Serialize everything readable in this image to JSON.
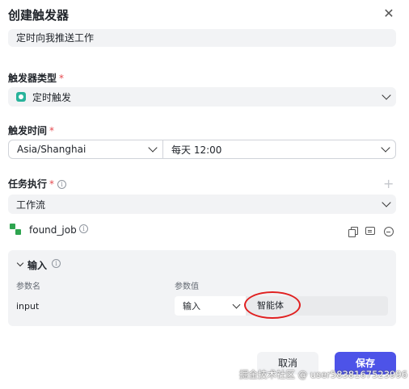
{
  "dialog": {
    "title": "创建触发器",
    "close_glyph": "✕"
  },
  "description": {
    "value": "定时向我推送工作"
  },
  "trigger_type": {
    "label": "触发器类型",
    "required_mark": "*",
    "selected": "定时触发",
    "icon": "timer-icon"
  },
  "trigger_time": {
    "label": "触发时间",
    "required_mark": "*",
    "timezone": "Asia/Shanghai",
    "schedule": "每天 12:00"
  },
  "task": {
    "label": "任务执行",
    "required_mark": "*",
    "info_glyph": "i",
    "add_glyph": "+",
    "executor": "工作流",
    "workflow": {
      "name": "found_job",
      "info_glyph": "i"
    }
  },
  "input_panel": {
    "title": "输入",
    "info_glyph": "i",
    "col_name": "参数名",
    "col_value": "参数值",
    "rows": [
      {
        "name": "input",
        "mode": "输入",
        "value": "智能体"
      }
    ]
  },
  "footer": {
    "cancel_label": "取消",
    "save_label": "保存"
  },
  "watermark": "掘金技术社区 @ user5838167523996",
  "colors": {
    "primary": "#4d53e8",
    "required": "#e5484d",
    "annotation": "#e02020",
    "workflow_icon": "#2ea44f",
    "timer_icon": "#29b39b"
  }
}
